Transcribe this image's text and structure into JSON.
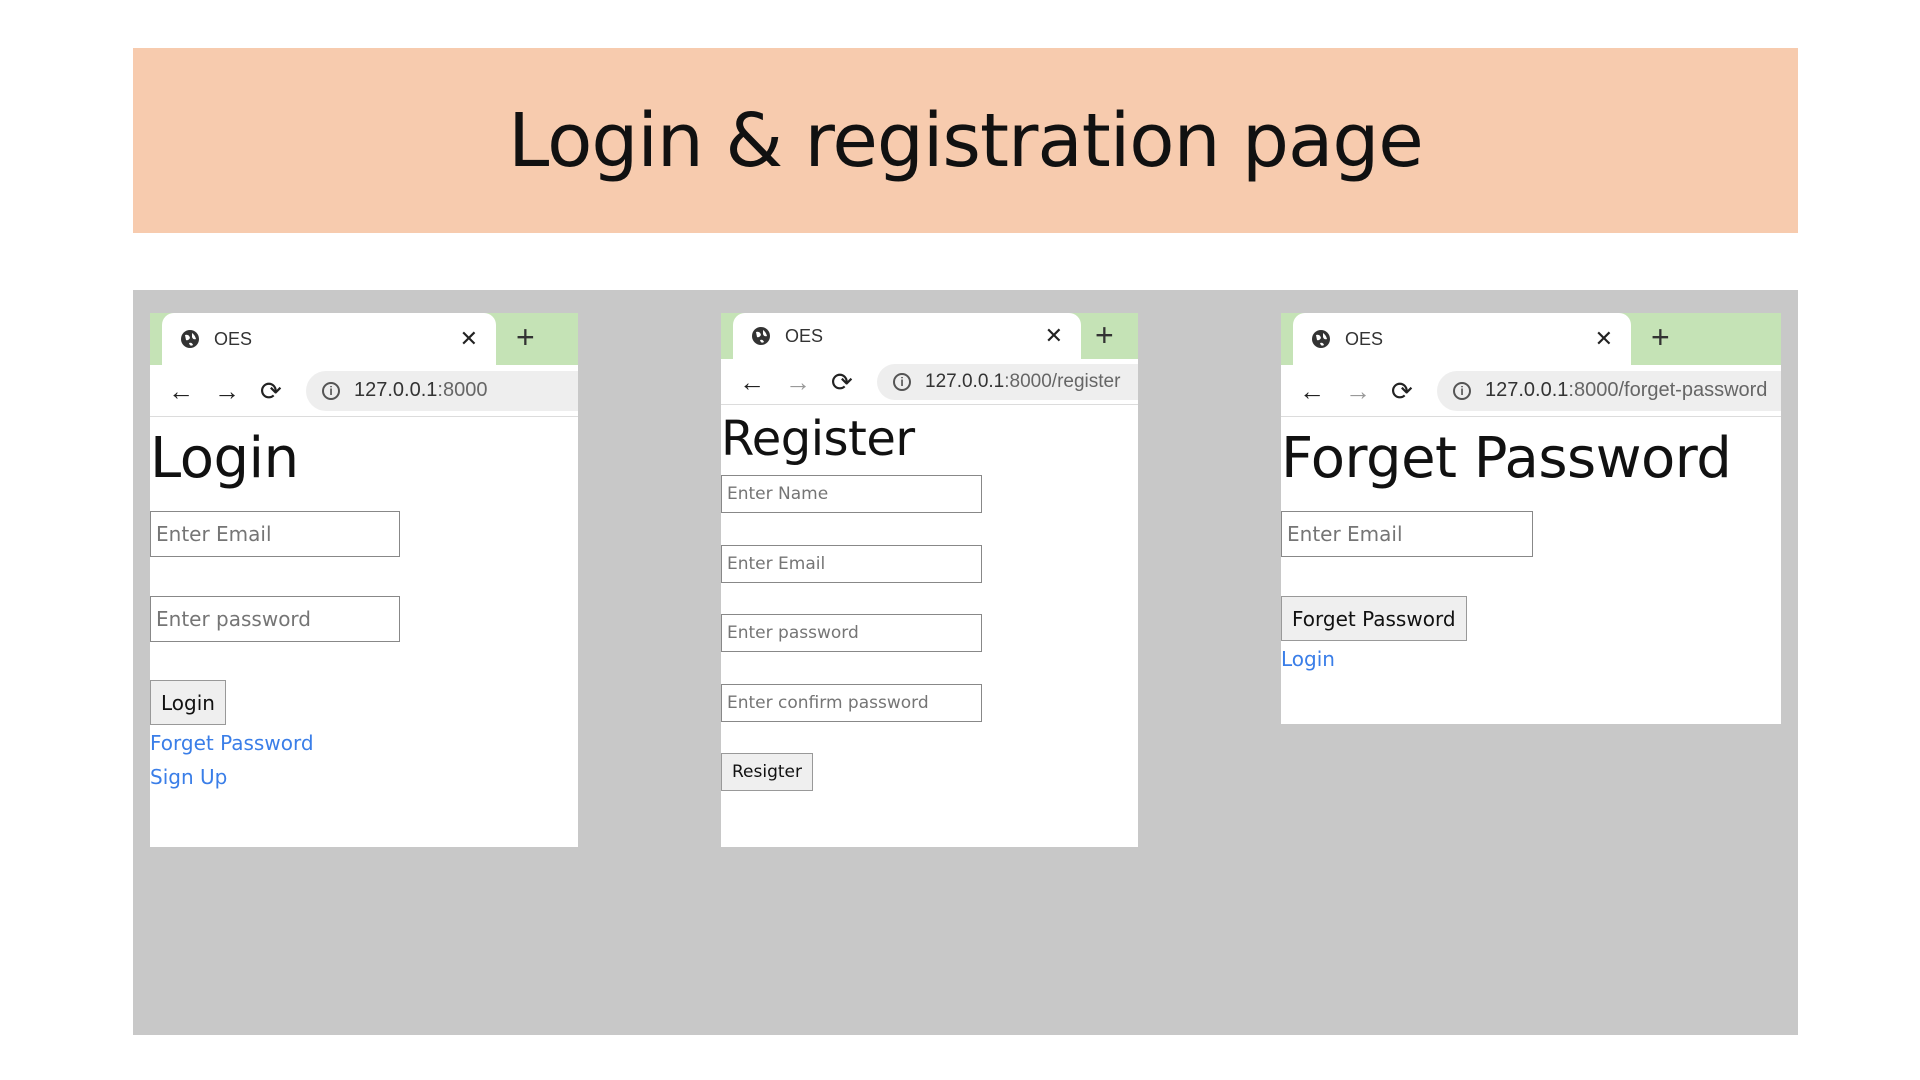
{
  "banner": {
    "title": "Login & registration page"
  },
  "login": {
    "tab_title": "OES",
    "url_host": "127.0.0.1",
    "url_path": ":8000",
    "heading": "Login",
    "email_placeholder": "Enter Email",
    "password_placeholder": "Enter password",
    "submit_label": "Login",
    "forget_link": "Forget Password",
    "signup_link": "Sign Up"
  },
  "register": {
    "tab_title": "OES",
    "url_host": "127.0.0.1",
    "url_path": ":8000/register",
    "heading": "Register",
    "name_placeholder": "Enter Name",
    "email_placeholder": "Enter Email",
    "password_placeholder": "Enter password",
    "confirm_placeholder": "Enter confirm password",
    "submit_label": "Resigter"
  },
  "forget": {
    "tab_title": "OES",
    "url_host": "127.0.0.1",
    "url_path": ":8000/forget-password",
    "heading": "Forget Password",
    "email_placeholder": "Enter Email",
    "submit_label": "Forget Password",
    "login_link": "Login"
  },
  "icons": {
    "globe": "globe-icon",
    "close": "close-icon",
    "new_tab": "plus-icon",
    "back": "back-arrow-icon",
    "forward": "forward-arrow-icon",
    "reload": "reload-icon",
    "info": "info-icon"
  },
  "colors": {
    "banner": "#f7cbae",
    "stage": "#c8c8c8",
    "tabbar": "#c5e3b6",
    "link": "#3a7ee8"
  }
}
